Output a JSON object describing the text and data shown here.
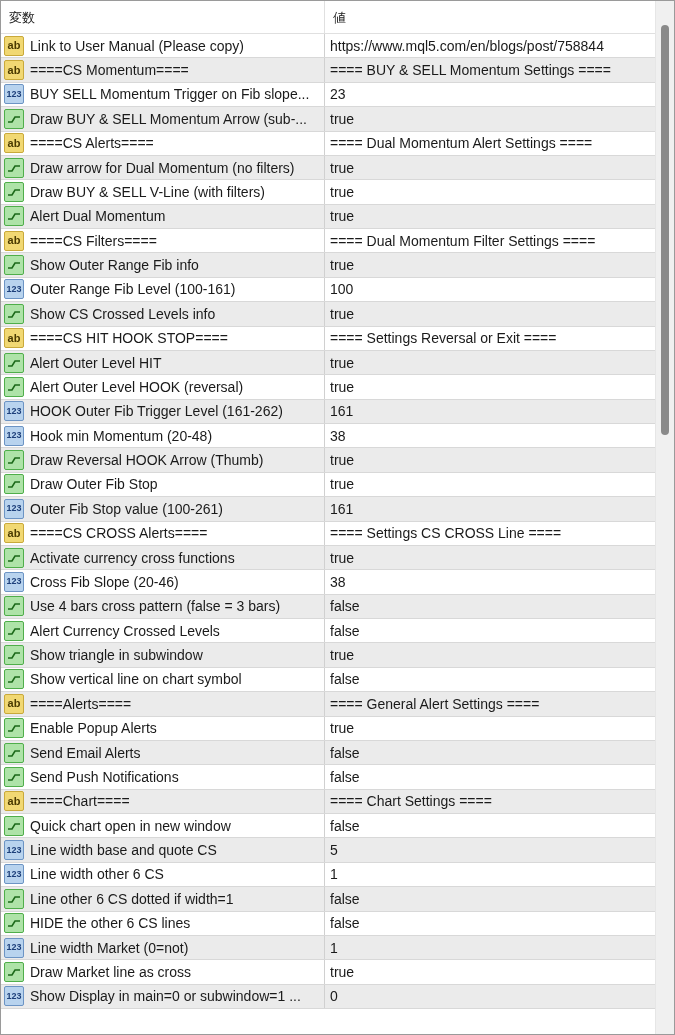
{
  "table": {
    "columns": [
      "変数",
      "値"
    ],
    "rows": [
      {
        "kind": "string",
        "icon_label": "ab",
        "name": "Link to User Manual (Please copy)",
        "value": "https://www.mql5.com/en/blogs/post/758844"
      },
      {
        "kind": "string",
        "icon_label": "ab",
        "name": "====CS Momentum====",
        "value": "==== BUY & SELL Momentum Settings ===="
      },
      {
        "kind": "int",
        "icon_label": "123",
        "name": "BUY SELL Momentum Trigger on Fib slope...",
        "value": "23"
      },
      {
        "kind": "bool",
        "name": "Draw BUY & SELL Momentum Arrow (sub-...",
        "value": "true"
      },
      {
        "kind": "string",
        "icon_label": "ab",
        "name": "====CS Alerts====",
        "value": "==== Dual Momentum Alert Settings ===="
      },
      {
        "kind": "bool",
        "name": "Draw arrow for Dual Momentum (no filters)",
        "value": "true"
      },
      {
        "kind": "bool",
        "name": "Draw BUY & SELL V-Line (with filters)",
        "value": "true"
      },
      {
        "kind": "bool",
        "name": "Alert Dual Momentum",
        "value": "true"
      },
      {
        "kind": "string",
        "icon_label": "ab",
        "name": "====CS Filters====",
        "value": "==== Dual Momentum Filter Settings ===="
      },
      {
        "kind": "bool",
        "name": "Show Outer Range Fib info",
        "value": "true"
      },
      {
        "kind": "int",
        "icon_label": "123",
        "name": "Outer Range Fib Level (100-161)",
        "value": "100"
      },
      {
        "kind": "bool",
        "name": "Show CS Crossed Levels info",
        "value": "true"
      },
      {
        "kind": "string",
        "icon_label": "ab",
        "name": "====CS HIT HOOK STOP====",
        "value": "==== Settings Reversal or Exit ===="
      },
      {
        "kind": "bool",
        "name": "Alert Outer Level HIT",
        "value": "true"
      },
      {
        "kind": "bool",
        "name": "Alert Outer Level HOOK (reversal)",
        "value": "true"
      },
      {
        "kind": "int",
        "icon_label": "123",
        "name": "HOOK Outer Fib Trigger Level (161-262)",
        "value": "161"
      },
      {
        "kind": "int",
        "icon_label": "123",
        "name": "Hook min Momentum (20-48)",
        "value": "38"
      },
      {
        "kind": "bool",
        "name": "Draw Reversal HOOK Arrow (Thumb)",
        "value": "true"
      },
      {
        "kind": "bool",
        "name": "Draw Outer Fib Stop",
        "value": "true"
      },
      {
        "kind": "int",
        "icon_label": "123",
        "name": "Outer Fib Stop value (100-261)",
        "value": "161"
      },
      {
        "kind": "string",
        "icon_label": "ab",
        "name": "====CS CROSS Alerts====",
        "value": "==== Settings CS CROSS Line ===="
      },
      {
        "kind": "bool",
        "name": "Activate currency cross functions",
        "value": "true"
      },
      {
        "kind": "int",
        "icon_label": "123",
        "name": "Cross Fib Slope (20-46)",
        "value": "38"
      },
      {
        "kind": "bool",
        "name": "Use 4 bars cross pattern (false = 3 bars)",
        "value": "false"
      },
      {
        "kind": "bool",
        "name": "Alert Currency Crossed Levels",
        "value": "false"
      },
      {
        "kind": "bool",
        "name": "Show triangle in subwindow",
        "value": "true"
      },
      {
        "kind": "bool",
        "name": "Show vertical line on chart symbol",
        "value": "false"
      },
      {
        "kind": "string",
        "icon_label": "ab",
        "name": "====Alerts====",
        "value": "==== General Alert Settings ===="
      },
      {
        "kind": "bool",
        "name": "Enable Popup Alerts",
        "value": "true"
      },
      {
        "kind": "bool",
        "name": "Send Email Alerts",
        "value": "false"
      },
      {
        "kind": "bool",
        "name": "Send Push Notifications",
        "value": "false"
      },
      {
        "kind": "string",
        "icon_label": "ab",
        "name": "====Chart====",
        "value": "==== Chart Settings ===="
      },
      {
        "kind": "bool",
        "name": "Quick chart open in new window",
        "value": "false"
      },
      {
        "kind": "int",
        "icon_label": "123",
        "name": "Line width base and quote CS",
        "value": "5"
      },
      {
        "kind": "int",
        "icon_label": "123",
        "name": "Line width other 6 CS",
        "value": "1"
      },
      {
        "kind": "bool",
        "name": "Line other 6 CS dotted if width=1",
        "value": "false"
      },
      {
        "kind": "bool",
        "name": "HIDE the other 6 CS lines",
        "value": "false"
      },
      {
        "kind": "int",
        "icon_label": "123",
        "name": "Line width Market (0=not)",
        "value": "1"
      },
      {
        "kind": "bool",
        "name": "Draw Market line as cross",
        "value": "true"
      },
      {
        "kind": "int",
        "icon_label": "123",
        "name": "Show Display in main=0 or subwindow=1 ...",
        "value": "0"
      }
    ]
  }
}
